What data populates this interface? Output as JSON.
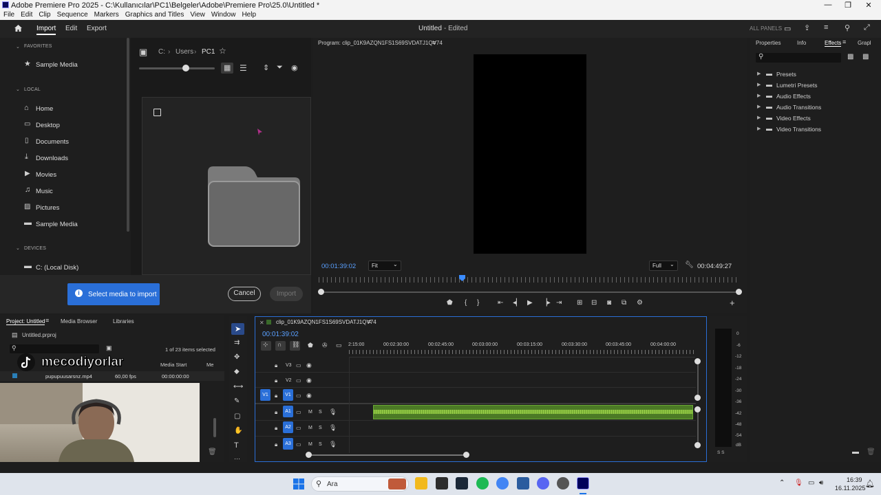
{
  "window": {
    "title": "Adobe Premiere Pro 2025 - C:\\Kullanıcılar\\PC1\\Belgeler\\Adobe\\Premiere Pro\\25.0\\Untitled *",
    "min": "—",
    "max": "❐",
    "close": "✕"
  },
  "menu": [
    "File",
    "Edit",
    "Clip",
    "Sequence",
    "Markers",
    "Graphics and Titles",
    "View",
    "Window",
    "Help"
  ],
  "workspace": {
    "tabs": [
      "Import",
      "Edit",
      "Export"
    ],
    "active": "Import",
    "doc_title": "Untitled",
    "doc_status": "- Edited",
    "all_panels": "ALL PANELS"
  },
  "import_sidebar": {
    "favorites_label": "FAVORITES",
    "favorites": [
      "Sample Media"
    ],
    "local_label": "LOCAL",
    "local": [
      "Home",
      "Desktop",
      "Documents",
      "Downloads",
      "Movies",
      "Music",
      "Pictures",
      "Sample Media"
    ],
    "devices_label": "DEVICES",
    "devices": [
      "C: (Local Disk)"
    ]
  },
  "browser": {
    "path": [
      "C:",
      "Users",
      "PC1"
    ]
  },
  "import_footer": {
    "select_msg": "Select media to import",
    "cancel": "Cancel",
    "import": "Import"
  },
  "program_monitor": {
    "title": "Program: clip_01K9AZQN1FS1S69SVDATJ1QV74",
    "timecode": "00:01:39:02",
    "fit": "Fit",
    "quality": "Full",
    "duration": "00:04:49:27"
  },
  "effects_panel": {
    "tabs": [
      "Properties",
      "Info",
      "Effects",
      "Grapl"
    ],
    "active": "Effects",
    "items": [
      "Presets",
      "Lumetri Presets",
      "Audio Effects",
      "Audio Transitions",
      "Video Effects",
      "Video Transitions"
    ]
  },
  "project_panel": {
    "tabs": [
      "Project: Untitled",
      "Media Browser",
      "Libraries"
    ],
    "file": "Untitled.prproj",
    "selection": "1 of 23 items selected",
    "columns": [
      "Media Start",
      "Me"
    ],
    "row": {
      "name": "pupupuusarsnz.mp4",
      "fps": "60,00 fps",
      "start": "00:00:00:00"
    }
  },
  "overlay": {
    "channel_name": "mecodiyorlar"
  },
  "timeline": {
    "sequence": "clip_01K9AZQN1FS1S69SVDATJ1QV74",
    "timecode": "00:01:39:02",
    "ruler": [
      "2:15:00",
      "00:02:30:00",
      "00:02:45:00",
      "00:03:00:00",
      "00:03:15:00",
      "00:03:30:00",
      "00:03:45:00",
      "00:04:00:00"
    ],
    "video_tracks": [
      "V3",
      "V2",
      "V1"
    ],
    "audio_tracks": [
      "A1",
      "A2",
      "A3"
    ],
    "source_patch": "V1",
    "m": "M",
    "s": "S"
  },
  "meter": {
    "scale": [
      "0",
      "-6",
      "-12",
      "-18",
      "-24",
      "-30",
      "-36",
      "-42",
      "-48",
      "-54",
      "dB"
    ],
    "solo": "S S"
  },
  "taskbar": {
    "search": "Ara",
    "time": "16:39",
    "date": "16.11.2025"
  },
  "colors": {
    "accent": "#2a6fd8",
    "audio_clip": "#5a9a2a",
    "bg": "#1d1d1d"
  }
}
